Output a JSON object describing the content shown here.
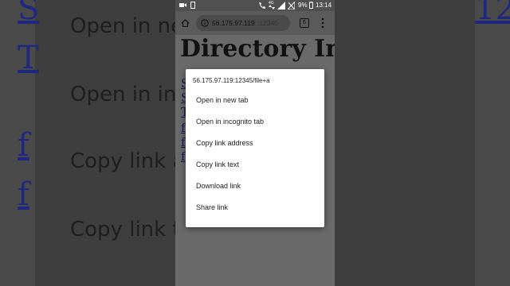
{
  "status_bar": {
    "network": "4G",
    "battery": "9%",
    "time": "13:14"
  },
  "browser": {
    "url_host": "56.175.97.119",
    "url_port": ":12345",
    "tab_count": "6"
  },
  "page": {
    "heading": "Directory In",
    "links": [
      "S",
      "S",
      "T",
      "f",
      "f",
      "f"
    ]
  },
  "background_zoom": {
    "left_links": [
      "S",
      "T",
      "f",
      "f"
    ],
    "right_text": "12",
    "menu_texts": [
      "Open in ne",
      "Open in inc",
      "Copy link a",
      "Copy link t"
    ]
  },
  "context_menu": {
    "title": "56.175.97.119:12345/file+a",
    "items": [
      {
        "label": "Open in new tab"
      },
      {
        "label": "Open in incognito tab"
      },
      {
        "label": "Copy link address"
      },
      {
        "label": "Copy link text"
      },
      {
        "label": "Download link"
      },
      {
        "label": "Share link"
      }
    ]
  },
  "colors": {
    "link": "#13175e",
    "menu_bg": "#ffffff",
    "scrim": "#6b6b6b"
  }
}
